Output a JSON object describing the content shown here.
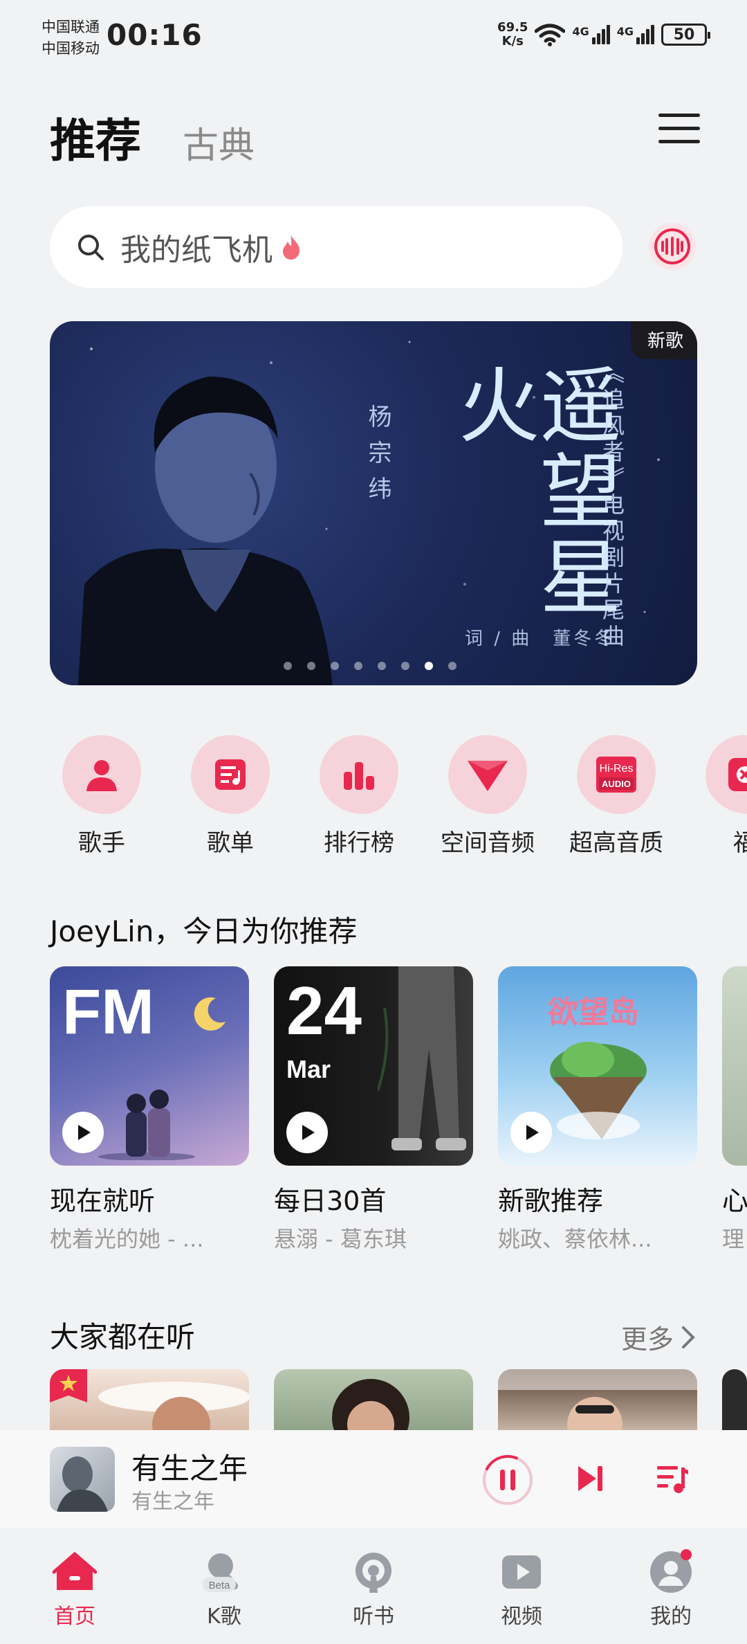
{
  "status_bar": {
    "carrier1": "中国联通",
    "carrier2": "中国移动",
    "time": "00:16",
    "net_speed_value": "69.5",
    "net_speed_unit": "K/s",
    "signal1_label": "4G",
    "signal2_label": "4G",
    "battery": "50"
  },
  "header": {
    "tab_active": "推荐",
    "tab_inactive": "古典"
  },
  "search": {
    "placeholder": "我的纸飞机"
  },
  "banner": {
    "badge": "新歌",
    "artist": "杨宗纬",
    "title": "遥望星火",
    "subtitle": "《追风者》电视剧片尾曲",
    "credit": "词 / 曲　董冬冬",
    "page_count": 8,
    "active_page": 7
  },
  "categories": [
    {
      "label": "歌手",
      "icon": "singer-icon"
    },
    {
      "label": "歌单",
      "icon": "playlist-icon"
    },
    {
      "label": "排行榜",
      "icon": "chart-icon"
    },
    {
      "label": "空间音频",
      "icon": "spatial-audio-icon"
    },
    {
      "label": "超高音质",
      "icon": "hi-res-icon"
    },
    {
      "label": "福",
      "icon": "welfare-icon"
    }
  ],
  "recommend": {
    "title": "JoeyLin，今日为你推荐",
    "cards": [
      {
        "title": "现在就听",
        "sub": "枕着光的她 - ...",
        "cover_text": "FM"
      },
      {
        "title": "每日30首",
        "sub": "悬溺 - 葛东琪",
        "cover_day": "24",
        "cover_month": "Mar"
      },
      {
        "title": "新歌推荐",
        "sub": "姚政、蔡依林...",
        "cover_text": "欲望岛"
      },
      {
        "title": "心",
        "sub": "理"
      }
    ]
  },
  "popular": {
    "title": "大家都在听",
    "more": "更多"
  },
  "player": {
    "title": "有生之年",
    "subtitle": "有生之年"
  },
  "nav": [
    {
      "label": "首页",
      "icon": "home-icon",
      "active": true
    },
    {
      "label": "K歌",
      "icon": "karaoke-icon",
      "beta": "Beta"
    },
    {
      "label": "听书",
      "icon": "audiobook-icon"
    },
    {
      "label": "视频",
      "icon": "video-icon"
    },
    {
      "label": "我的",
      "icon": "profile-icon"
    }
  ],
  "colors": {
    "accent": "#e8284e",
    "background": "#f1f2f4",
    "category_blob": "#f6d3da"
  }
}
